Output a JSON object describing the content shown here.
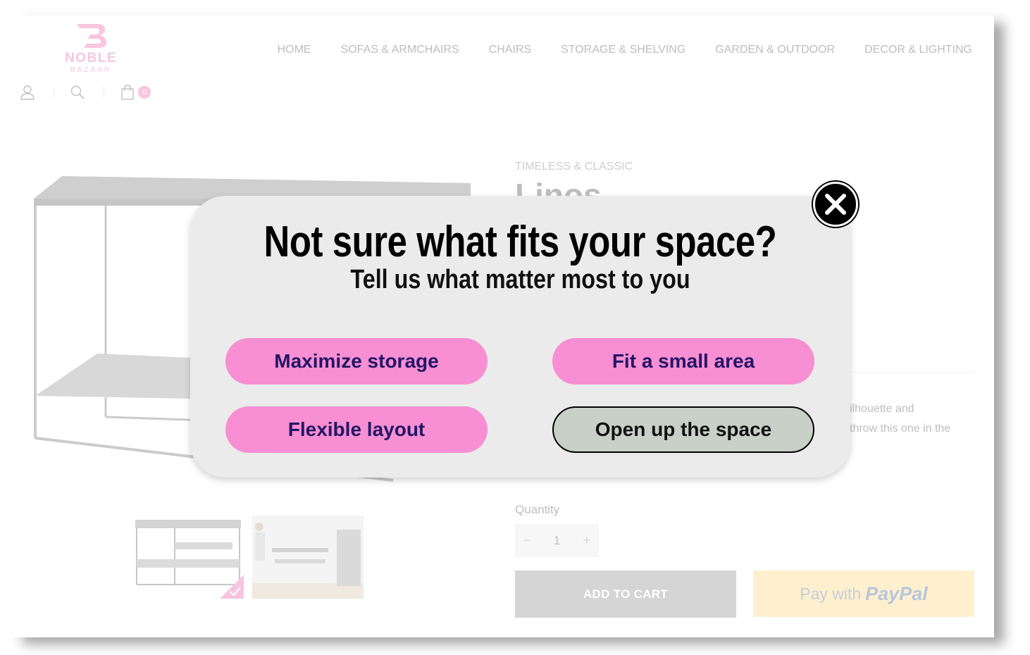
{
  "header": {
    "logo_name": "NOBLE",
    "logo_sub": "BAZAAR",
    "nav": [
      "HOME",
      "SOFAS & ARMCHAIRS",
      "CHAIRS",
      "STORAGE & SHELVING",
      "GARDEN & OUTDOOR",
      "DECOR & LIGHTING"
    ],
    "icons": [
      "user-icon",
      "search-icon",
      "shopping-bag-icon"
    ],
    "cart_count": "0"
  },
  "product": {
    "brand_tag": "TIMELESS & CLASSIC",
    "title_partial": "Linos",
    "desc_line1": "silhouette and",
    "desc_line2": "throw this one in the",
    "quantity_label": "Quantity",
    "quantity_value": "1",
    "qty_minus": "−",
    "qty_plus": "+",
    "add_to_cart": "ADD TO CART",
    "paypal_prefix": "Pay with",
    "paypal_brand": "PayPal"
  },
  "modal": {
    "title": "Not sure what fits your space?",
    "subtitle": "Tell us what matter most to you",
    "options": [
      "Maximize storage",
      "Fit a small area",
      "Flexible layout",
      "Open up the space"
    ],
    "close_icon": "close-icon"
  },
  "colors": {
    "brand_pink": "#f5a7cf",
    "option_pink": "#f78fd2",
    "option_text": "#241566",
    "option_selected": "#c8d0c8",
    "modal_bg": "#ebebeb"
  }
}
